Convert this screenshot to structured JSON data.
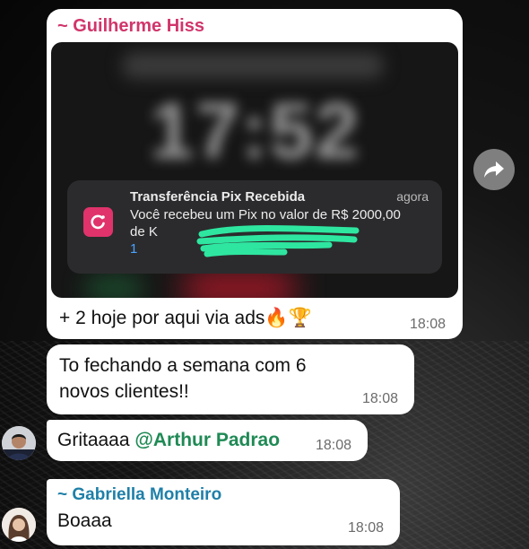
{
  "chat": {
    "messages": [
      {
        "sender": "~ Guilherme Hiss",
        "screenshot": {
          "clock": "17:52",
          "notification": {
            "title": "Transferência Pix Recebida",
            "time": "agora",
            "line1": "Você recebeu um Pix no valor de R$ 2000,00",
            "line2": "de K",
            "line3": "1"
          }
        },
        "text": "+ 2 hoje por aqui via ads🔥🏆",
        "time": "18:08"
      },
      {
        "text": "To fechando a semana com 6 novos clientes!!",
        "time": "18:08"
      },
      {
        "text_prefix": "Gritaaaa ",
        "mention": "@Arthur Padrao",
        "time": "18:08"
      },
      {
        "sender": "~ Gabriella Monteiro",
        "text": "Boaaa",
        "time": "18:08"
      }
    ]
  },
  "colors": {
    "sender1": "#d1356b",
    "sender2": "#1f7fa8",
    "mention": "#1f8a55",
    "pix_icon": "#e0336b",
    "scribble": "#2ee6a0"
  },
  "icons": {
    "forward": "forward-arrow-icon",
    "app": "pix-app-icon"
  }
}
